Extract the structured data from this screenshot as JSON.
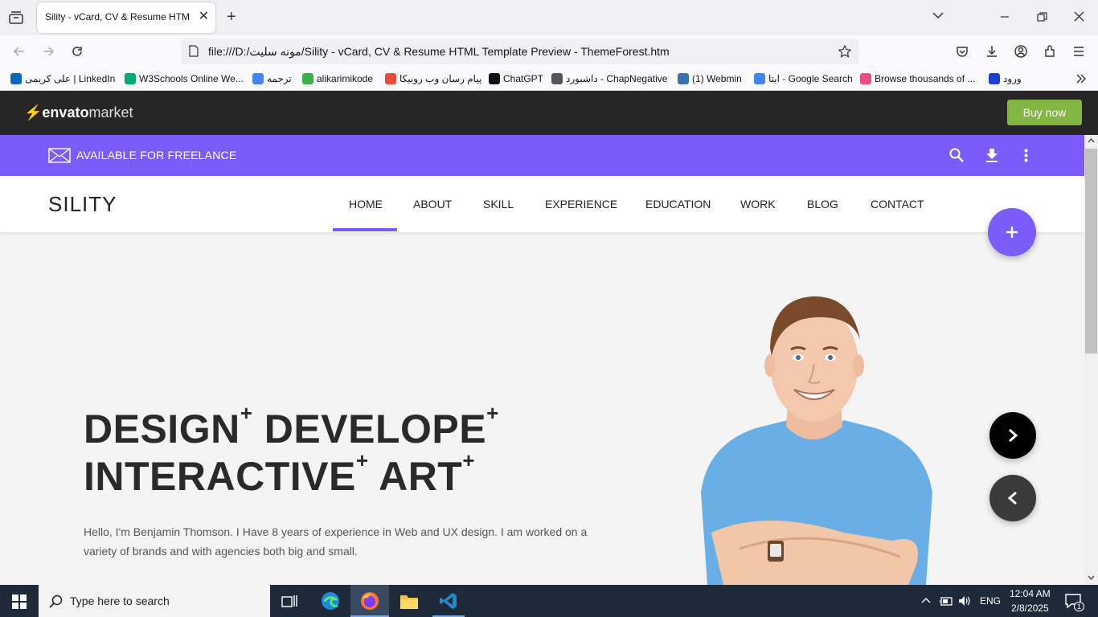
{
  "browser": {
    "tab_title": "Sility - vCard, CV & Resume HTML Template Preview - ThemeForest.htm",
    "url": "file:///D:/مونه سلیت/Sility - vCard, CV & Resume HTML Template Preview - ThemeForest.htm",
    "bookmarks": [
      {
        "label": "علی کریمی | LinkedIn",
        "icon": "linkedin-icon",
        "color": "#0a66c2"
      },
      {
        "label": "W3Schools Online We...",
        "icon": "w3schools-icon",
        "color": "#04aa6d"
      },
      {
        "label": "ترجمه",
        "icon": "translate-icon",
        "color": "#4285f4"
      },
      {
        "label": "alikarimikode",
        "icon": "check-icon",
        "color": "#3cb043"
      },
      {
        "label": "پیام رسان وب روبیکا",
        "icon": "rubika-icon",
        "color": "#e74c3c"
      },
      {
        "label": "ChatGPT",
        "icon": "chatgpt-icon",
        "color": "#111111"
      },
      {
        "label": "داشبورد - ChapNegative",
        "icon": "globe-icon",
        "color": "#555555"
      },
      {
        "label": "(1) Webmin",
        "icon": "webmin-icon",
        "color": "#3a6fb0"
      },
      {
        "label": "ایتا - Google Search",
        "icon": "google-icon",
        "color": "#4285f4"
      },
      {
        "label": "Browse thousands of ...",
        "icon": "dribbble-icon",
        "color": "#ea4c89"
      },
      {
        "label": "ورود",
        "icon": "bag-icon",
        "color": "#1a3fd1"
      }
    ]
  },
  "envato": {
    "logo_bold": "envato",
    "logo_light": "market",
    "buy_label": "Buy now",
    "accent": "#82b541"
  },
  "freelance": {
    "text": "AVAILABLE FOR FREELANCE",
    "accent": "#7b5cfa"
  },
  "header": {
    "brand": "SILITY",
    "nav": [
      "HOME",
      "ABOUT",
      "SKILL",
      "EXPERIENCE",
      "EDUCATION",
      "WORK",
      "BLOG",
      "CONTACT"
    ],
    "active": "HOME"
  },
  "hero": {
    "line1": [
      {
        "word": "DESIGN",
        "sup": "+"
      },
      {
        "word": "DEVELOPE",
        "sup": "+"
      }
    ],
    "line2": [
      {
        "word": "INTERACTIVE",
        "sup": "+"
      },
      {
        "word": "ART",
        "sup": "+"
      }
    ],
    "paragraph": "Hello, I'm Benjamin Thomson. I Have 8 years of experience in Web and UX design. I am worked on a variety of brands and with agencies both big and small."
  },
  "taskbar": {
    "search_placeholder": "Type here to search",
    "language": "ENG",
    "time": "12:04 AM",
    "date": "2/8/2025",
    "notification_count": "1"
  }
}
